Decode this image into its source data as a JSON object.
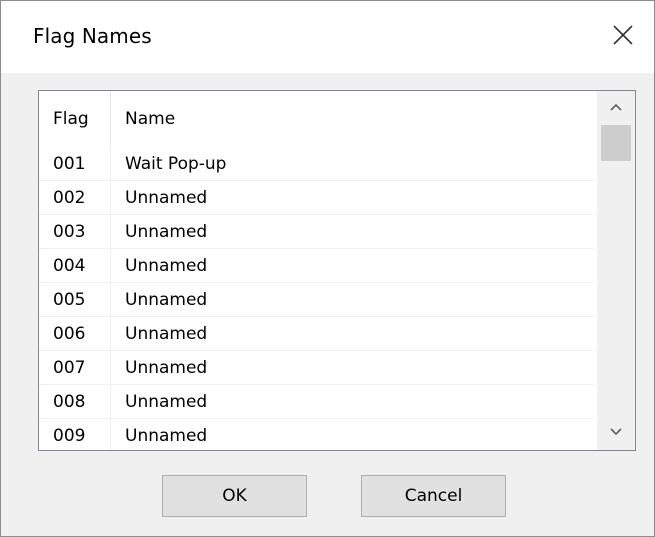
{
  "dialog": {
    "title": "Flag Names"
  },
  "list": {
    "columns": [
      "Flag",
      "Name"
    ],
    "rows": [
      {
        "flag": "001",
        "name": "Wait Pop-up"
      },
      {
        "flag": "002",
        "name": "Unnamed"
      },
      {
        "flag": "003",
        "name": "Unnamed"
      },
      {
        "flag": "004",
        "name": "Unnamed"
      },
      {
        "flag": "005",
        "name": "Unnamed"
      },
      {
        "flag": "006",
        "name": "Unnamed"
      },
      {
        "flag": "007",
        "name": "Unnamed"
      },
      {
        "flag": "008",
        "name": "Unnamed"
      },
      {
        "flag": "009",
        "name": "Unnamed"
      }
    ]
  },
  "buttons": {
    "ok": "OK",
    "cancel": "Cancel"
  },
  "icons": {
    "close": "close-icon",
    "scroll_up": "chevron-up-icon",
    "scroll_down": "chevron-down-icon"
  }
}
